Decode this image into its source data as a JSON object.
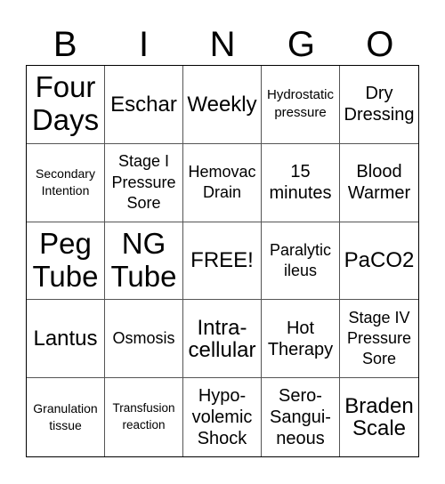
{
  "header": {
    "letters": [
      "B",
      "I",
      "N",
      "G",
      "O"
    ]
  },
  "cells": [
    {
      "text": "Four Days",
      "size": "xl"
    },
    {
      "text": "Eschar",
      "size": "l"
    },
    {
      "text": "Weekly",
      "size": "l"
    },
    {
      "text": "Hydrostatic pressure",
      "size": "xs"
    },
    {
      "text": "Dry Dressing",
      "size": "m"
    },
    {
      "text": "Secondary Intention",
      "size": "xxs"
    },
    {
      "text": "Stage I Pressure Sore",
      "size": "s"
    },
    {
      "text": "Hemovac Drain",
      "size": "s"
    },
    {
      "text": "15 minutes",
      "size": "m"
    },
    {
      "text": "Blood Warmer",
      "size": "m"
    },
    {
      "text": "Peg Tube",
      "size": "xl"
    },
    {
      "text": "NG Tube",
      "size": "xl"
    },
    {
      "text": "FREE!",
      "size": "l"
    },
    {
      "text": "Paralytic ileus",
      "size": "s"
    },
    {
      "text": "PaCO2",
      "size": "l"
    },
    {
      "text": "Lantus",
      "size": "l"
    },
    {
      "text": "Osmosis",
      "size": "s"
    },
    {
      "text": "Intra-cellular",
      "size": "l"
    },
    {
      "text": "Hot Therapy",
      "size": "m"
    },
    {
      "text": "Stage IV Pressure Sore",
      "size": "s"
    },
    {
      "text": "Granulation tissue",
      "size": "xxs"
    },
    {
      "text": "Transfusion reaction",
      "size": "tiny"
    },
    {
      "text": "Hypo-volemic Shock",
      "size": "m"
    },
    {
      "text": "Sero-Sangui-neous",
      "size": "m"
    },
    {
      "text": "Braden Scale",
      "size": "l"
    }
  ]
}
